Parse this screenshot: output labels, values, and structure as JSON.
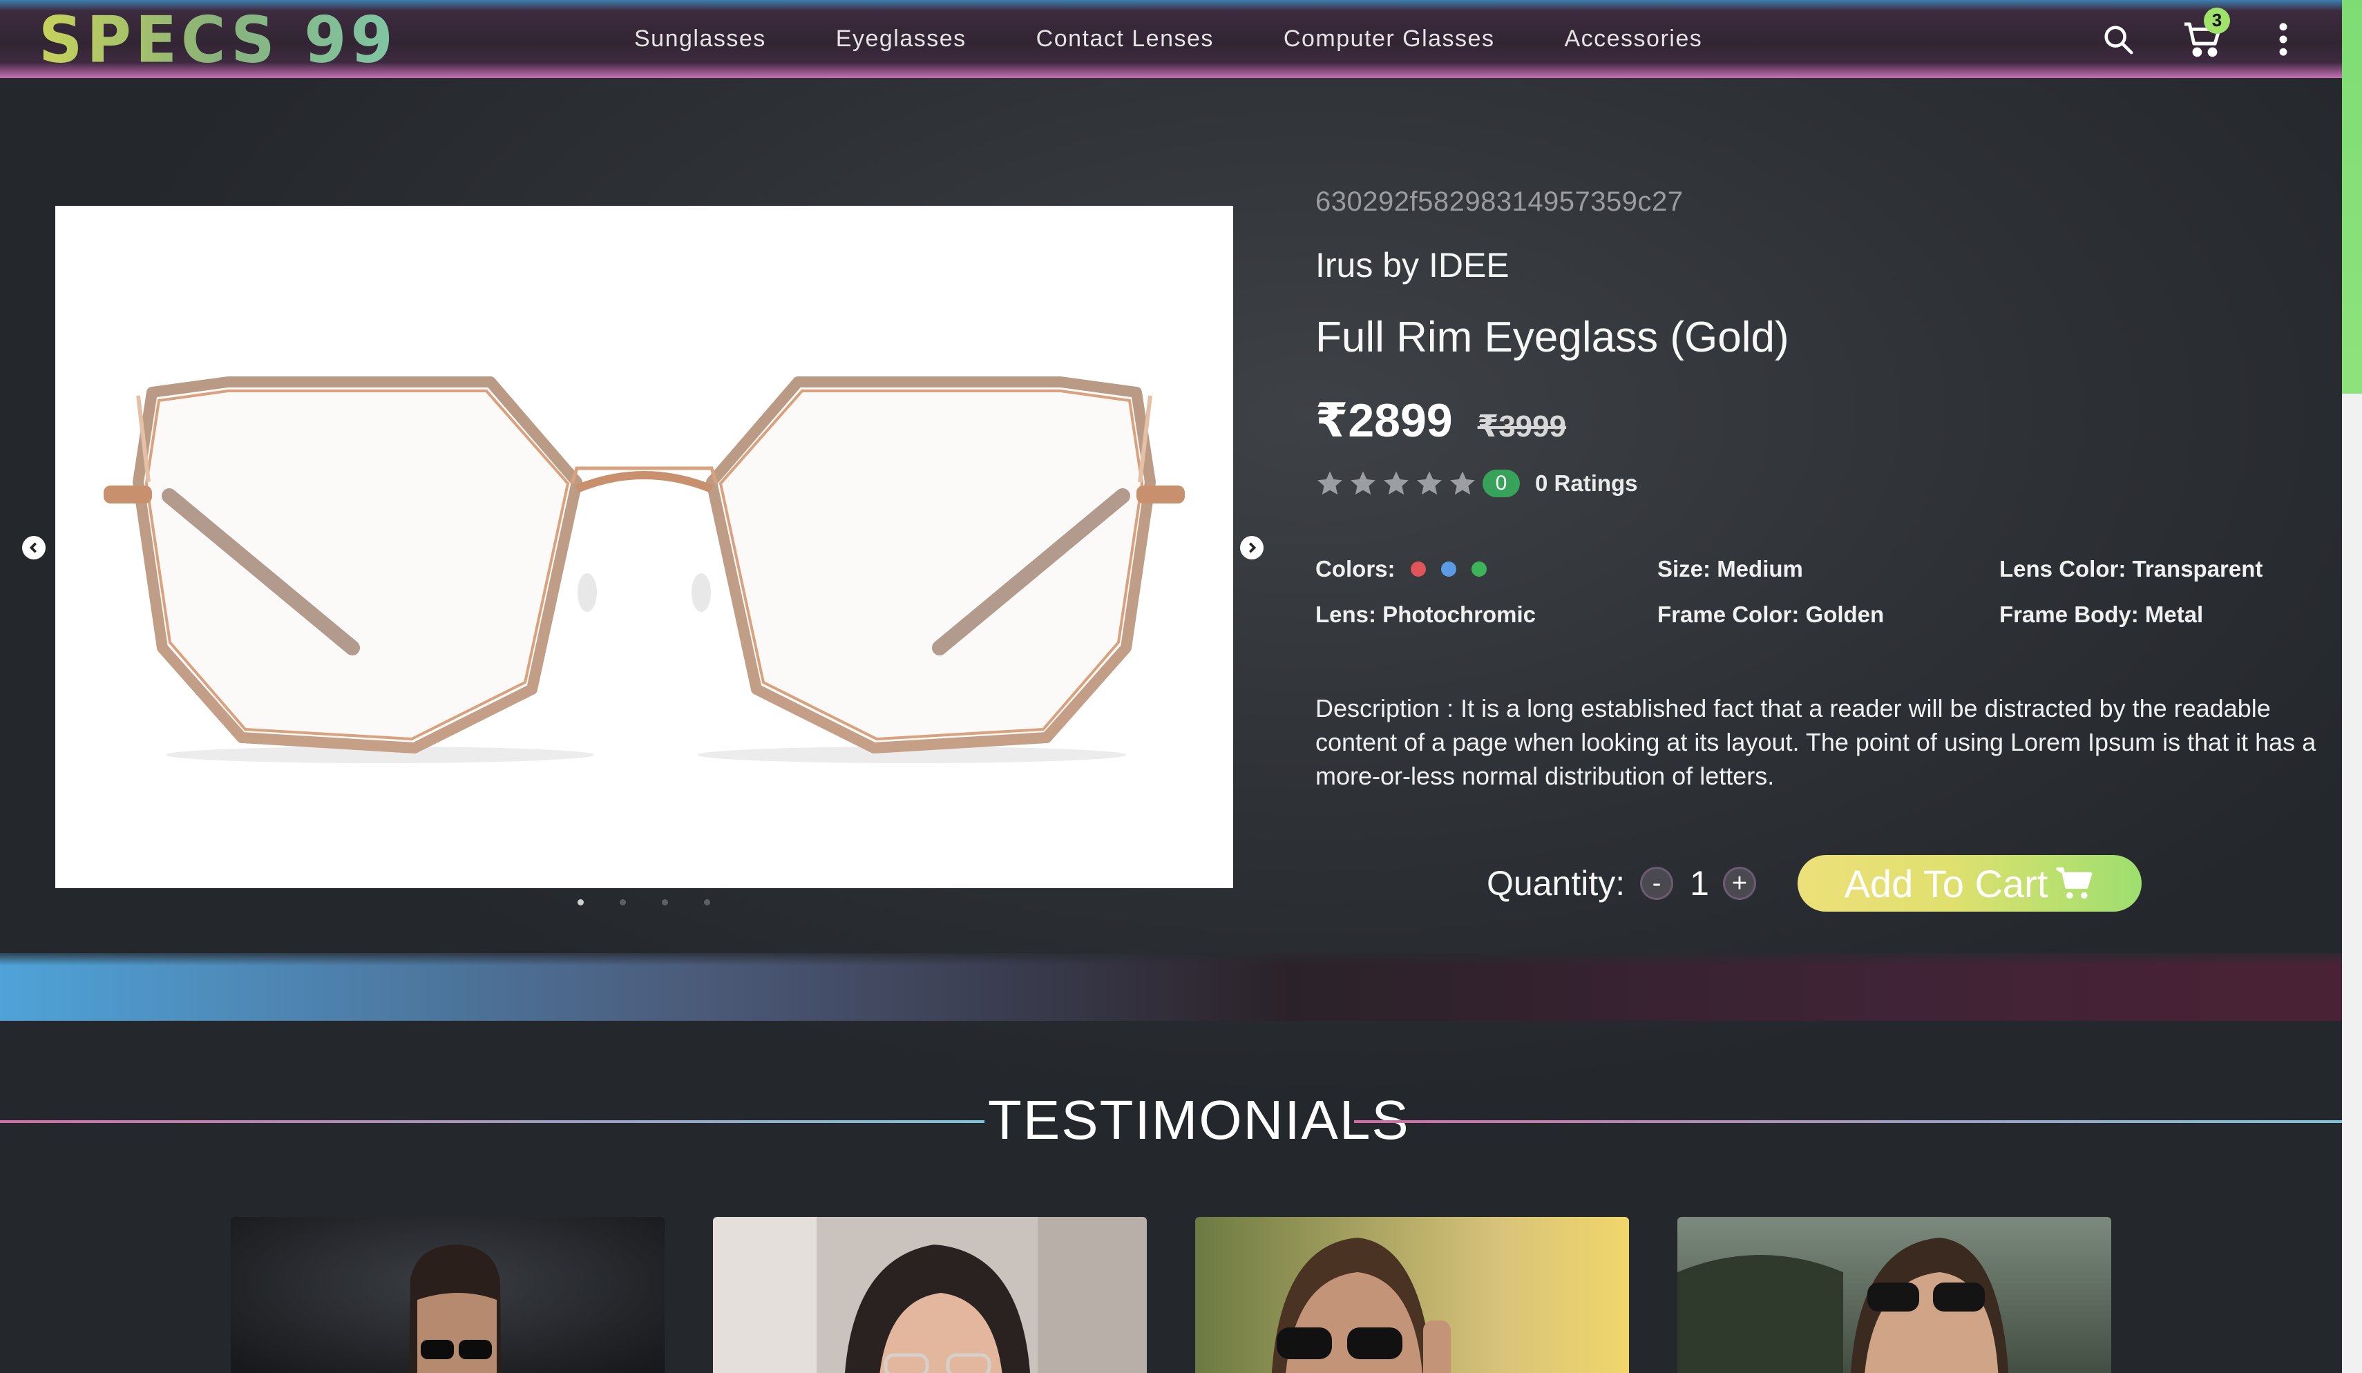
{
  "nav": {
    "logo": "SPECS 99",
    "links": [
      "Sunglasses",
      "Eyeglasses",
      "Contact Lenses",
      "Computer Glasses",
      "Accessories"
    ],
    "cart_count": "3"
  },
  "product": {
    "id": "630292f58298314957359c27",
    "brand": "Irus by IDEE",
    "title": "Full Rim Eyeglass (Gold)",
    "price": "₹2899",
    "mrp": "₹3999",
    "rating_value": "0",
    "ratings_text": "0 Ratings",
    "stars": 5,
    "attributes": {
      "colors_label": "Colors:",
      "colors": [
        "#e0545a",
        "#5b9be6",
        "#3db45a"
      ],
      "size": "Size: Medium",
      "lens_color": "Lens Color: Transparent",
      "lens": "Lens: Photochromic",
      "frame_color": "Frame Color: Golden",
      "frame_body": "Frame Body: Metal"
    },
    "description_label": "Description :",
    "description": " It is a long established fact that a reader will be distracted by the readable content of a page when looking at its layout. The point of using Lorem Ipsum is that it has a more-or-less normal distribution of letters.",
    "quantity_label": "Quantity:",
    "quantity": "1",
    "minus": "-",
    "plus": "+",
    "add_to_cart": "Add To Cart",
    "carousel_count": 4,
    "carousel_active": 0
  },
  "testimonials": {
    "title": "TESTIMONIALS"
  },
  "colors": {
    "rating_badge": "#36a25a",
    "cart_badge": "#9fe36a",
    "add_to_cart_start": "#ede07a",
    "add_to_cart_end": "#9ddf6f"
  }
}
